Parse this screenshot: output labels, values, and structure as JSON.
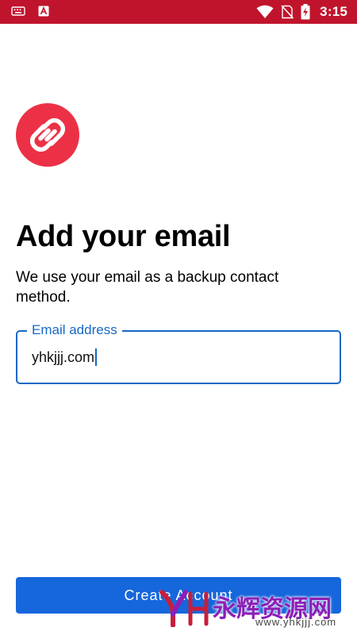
{
  "status_bar": {
    "time": "3:15",
    "icons": [
      "keyboard-icon",
      "app-notification-icon",
      "wifi-icon",
      "no-sim-icon",
      "battery-charging-icon"
    ],
    "background_color": "#c0142c"
  },
  "logo": {
    "icon": "authy-logo-icon",
    "color": "#ec3146"
  },
  "main": {
    "title": "Add your email",
    "description": "We use your email as a backup contact method."
  },
  "email_field": {
    "label": "Email address",
    "value": "yhkjjj.com",
    "focused": true,
    "accent_color": "#1668c6"
  },
  "create_button": {
    "label": "Create Account",
    "color": "#1667dc"
  },
  "watermark": {
    "text": "永辉资源网",
    "url": "www.yhkjjj.com"
  }
}
